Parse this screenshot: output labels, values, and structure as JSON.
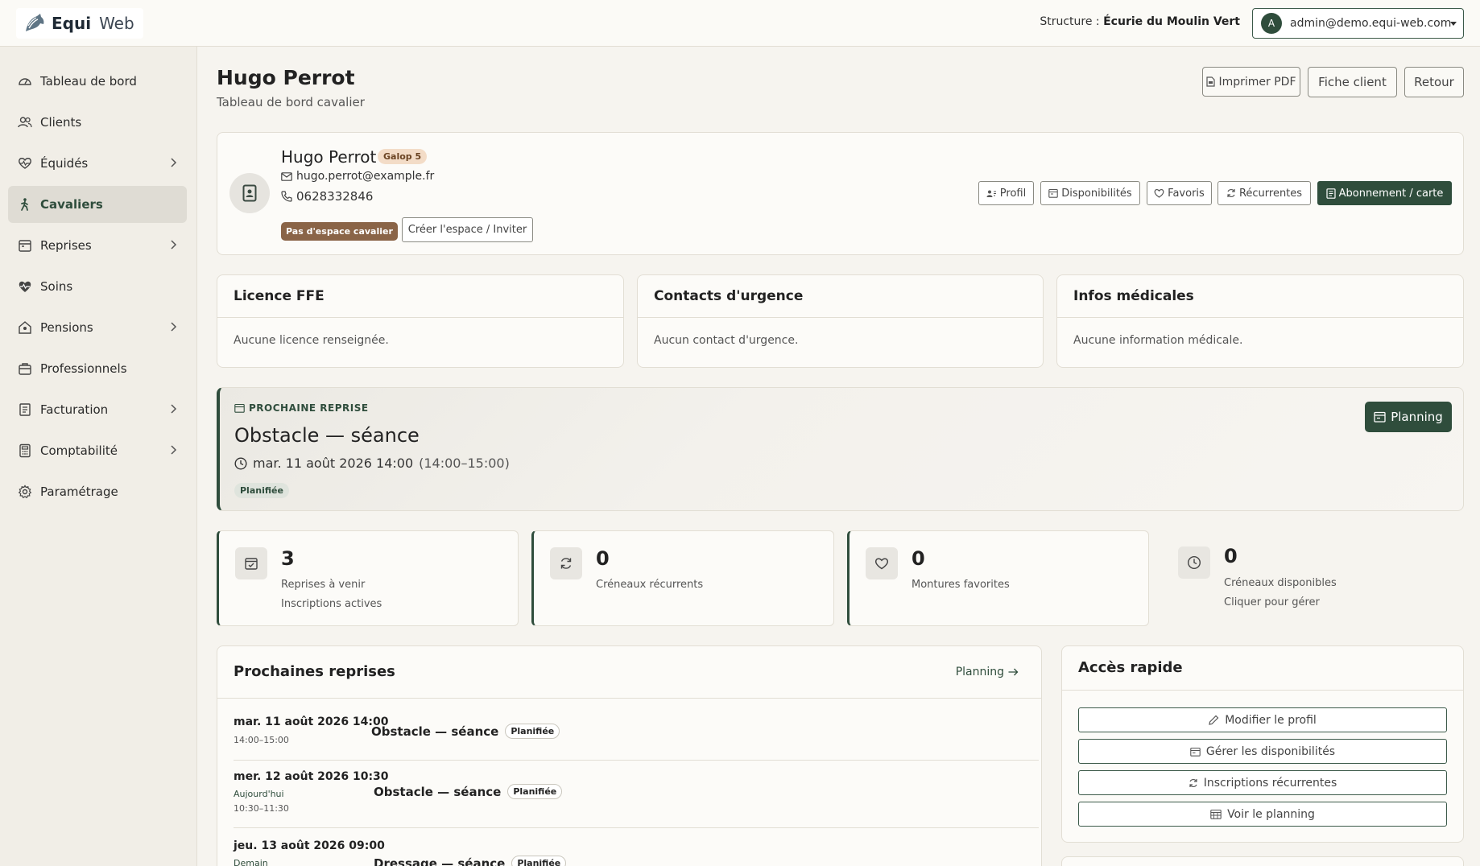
{
  "app": {
    "logo_primary": "Equi",
    "logo_secondary": "Web"
  },
  "topbar": {
    "structure_label": "Structure :",
    "structure_name": "Écurie du Moulin Vert",
    "user_initial": "A",
    "user_email": "admin@demo.equi-web.com"
  },
  "sidebar": {
    "items": [
      {
        "label": "Tableau de bord",
        "icon": "gauge-icon"
      },
      {
        "label": "Clients",
        "icon": "users-icon"
      },
      {
        "label": "Équidés",
        "icon": "heart-pulse-icon",
        "expandable": true
      },
      {
        "label": "Cavaliers",
        "icon": "rider-icon",
        "active": true
      },
      {
        "label": "Reprises",
        "icon": "calendar-icon",
        "expandable": true
      },
      {
        "label": "Soins",
        "icon": "heart-icon"
      },
      {
        "label": "Pensions",
        "icon": "house-icon",
        "expandable": true
      },
      {
        "label": "Professionnels",
        "icon": "briefcase-icon"
      },
      {
        "label": "Facturation",
        "icon": "invoice-icon",
        "expandable": true
      },
      {
        "label": "Comptabilité",
        "icon": "calculator-icon",
        "expandable": true
      },
      {
        "label": "Paramétrage",
        "icon": "gear-icon"
      }
    ]
  },
  "page": {
    "title": "Hugo Perrot",
    "subtitle": "Tableau de bord cavalier",
    "actions": {
      "print": "Imprimer PDF",
      "client": "Fiche client",
      "back": "Retour"
    }
  },
  "profile": {
    "name": "Hugo Perrot",
    "level": "Galop 5",
    "email": "hugo.perrot@example.fr",
    "phone": "0628332846",
    "space_status": "Pas d'espace cavalier",
    "invite_label": "Créer l'espace / Inviter",
    "buttons": {
      "profil": "Profil",
      "dispo": "Disponibilités",
      "favoris": "Favoris",
      "recurrentes": "Récurrentes",
      "abonnement": "Abonnement / carte"
    }
  },
  "info_cards": {
    "licence": {
      "title": "Licence FFE",
      "body": "Aucune licence renseignée."
    },
    "contacts": {
      "title": "Contacts d'urgence",
      "body": "Aucun contact d'urgence."
    },
    "medical": {
      "title": "Infos médicales",
      "body": "Aucune information médicale."
    }
  },
  "next_lesson": {
    "label": "PROCHAINE REPRISE",
    "title": "Obstacle — séance",
    "datetime": "mar. 11 août 2026 14:00",
    "range": "(14:00–15:00)",
    "status": "Planifiée",
    "planning_label": "Planning"
  },
  "stats": {
    "upcoming": {
      "value": "3",
      "label": "Reprises à venir",
      "sub": "Inscriptions actives"
    },
    "recurring": {
      "value": "0",
      "label": "Créneaux récurrents"
    },
    "favorites": {
      "value": "0",
      "label": "Montures favorites"
    },
    "available": {
      "value": "0",
      "label": "Créneaux disponibles",
      "sub": "Cliquer pour gérer"
    }
  },
  "upcoming_list": {
    "title": "Prochaines reprises",
    "link": "Planning",
    "rows": [
      {
        "date": "mar. 11 août 2026 14:00",
        "relative": "",
        "range": "14:00–15:00",
        "title": "Obstacle — séance",
        "status": "Planifiée"
      },
      {
        "date": "mer. 12 août 2026 10:30",
        "relative": "Aujourd'hui",
        "range": "10:30–11:30",
        "title": "Obstacle — séance",
        "status": "Planifiée"
      },
      {
        "date": "jeu. 13 août 2026 09:00",
        "relative": "Demain",
        "range": "",
        "title": "Dressage — séance",
        "status": "Planifiée"
      }
    ]
  },
  "quick_access": {
    "title": "Accès rapide",
    "buttons": {
      "edit": "Modifier le profil",
      "dispo": "Gérer les disponibilités",
      "recurrent": "Inscriptions récurrentes",
      "planning": "Voir le planning"
    }
  }
}
